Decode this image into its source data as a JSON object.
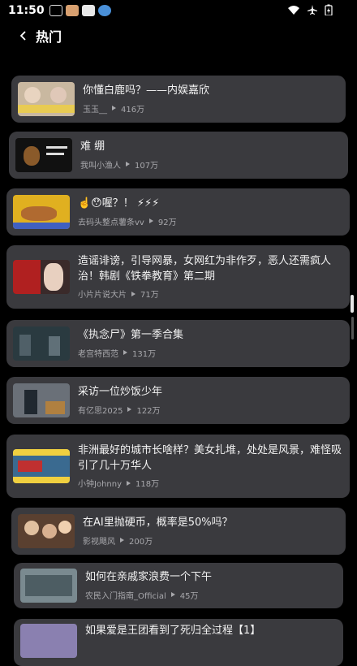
{
  "status_bar": {
    "time": "11:50"
  },
  "header": {
    "title": "热门"
  },
  "items": [
    {
      "title": "你懂白鹿吗？——内娱嘉欣",
      "author": "玉玉__",
      "views": "416万",
      "thumb_color": "#c9b8a0"
    },
    {
      "title": "难 绷",
      "author": "我叫小渔人",
      "views": "107万",
      "thumb_color": "#111111"
    },
    {
      "title": "☝️😯喔？！ ⚡⚡⚡",
      "author": "去码头整点薯条vv",
      "views": "92万",
      "thumb_color": "#e0b020"
    },
    {
      "title": "造谣诽谤，引导网暴，女网红为非作歹，恶人还需疯人治！韩剧《铁拳教育》第二期",
      "author": "小片片说大片",
      "views": "71万",
      "thumb_color": "#b02020"
    },
    {
      "title": "《执念尸》第一季合集",
      "author": "老宫特西范",
      "views": "131万",
      "thumb_color": "#2a3a40"
    },
    {
      "title": "采访一位炒饭少年",
      "author": "有亿思2025",
      "views": "122万",
      "thumb_color": "#6a7078"
    },
    {
      "title": "非洲最好的城市长啥样？美女扎堆，处处是风景，难怪吸引了几十万华人",
      "author": "小钟Johnny",
      "views": "118万",
      "thumb_color": "#3a6a90"
    },
    {
      "title": "在AI里抛硬币，概率是50%吗？",
      "author": "影视飓风",
      "views": "200万",
      "thumb_color": "#5a4030"
    },
    {
      "title": "如何在亲戚家浪费一个下午",
      "author": "农民入门指南_Official",
      "views": "45万",
      "thumb_color": "#7a8a90"
    },
    {
      "title": "如果爱是王团看到了死归全过程【1】",
      "author": "",
      "views": "",
      "thumb_color": "#8a80b0"
    }
  ]
}
